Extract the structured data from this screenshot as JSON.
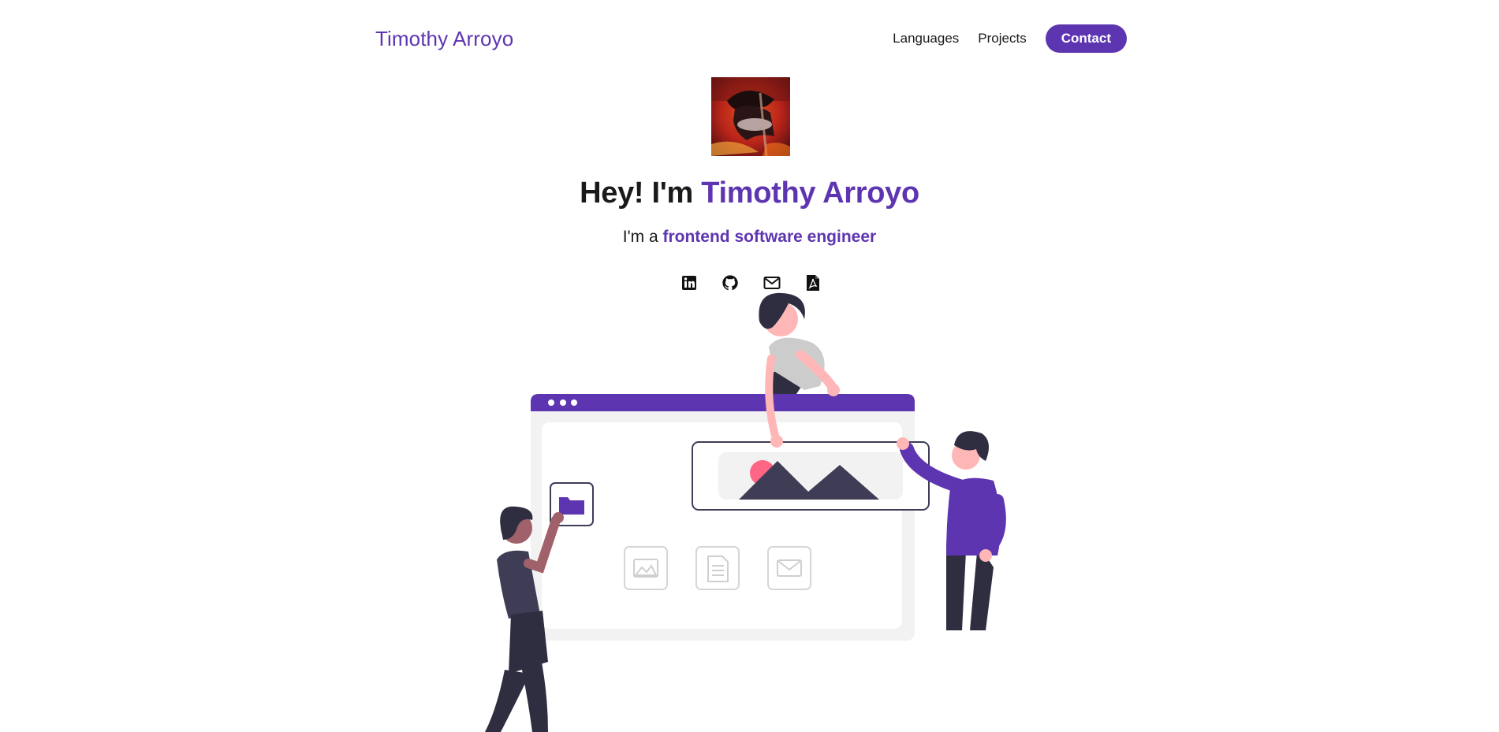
{
  "nav": {
    "brand": "Timothy Arroyo",
    "links": [
      "Languages",
      "Projects"
    ],
    "contact_label": "Contact"
  },
  "hero": {
    "greeting": "Hey! I'm ",
    "name": "Timothy Arroyo",
    "subtitle_prefix": "I'm a ",
    "role": "frontend software engineer"
  },
  "socials": [
    {
      "icon": "linkedin-icon"
    },
    {
      "icon": "github-icon"
    },
    {
      "icon": "envelope-icon"
    },
    {
      "icon": "pdf-file-icon"
    }
  ],
  "colors": {
    "accent": "#5e35b1",
    "text": "#1a1a1a"
  }
}
